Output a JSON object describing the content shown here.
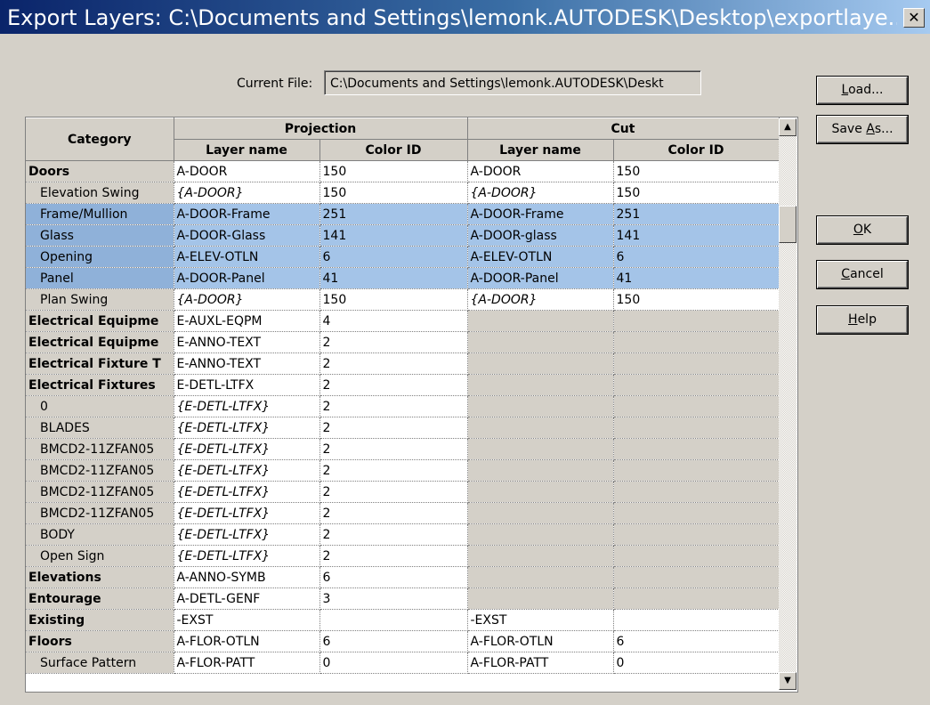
{
  "window": {
    "title": "Export Layers: C:\\Documents and Settings\\lemonk.AUTODESK\\Desktop\\exportlaye...",
    "close_glyph": "✕"
  },
  "current_file": {
    "label": "Current File:",
    "value": "C:\\Documents and Settings\\lemonk.AUTODESK\\Deskt"
  },
  "buttons": {
    "load": {
      "pre": "",
      "u": "L",
      "post": "oad..."
    },
    "save_as": {
      "pre": "Save ",
      "u": "A",
      "post": "s..."
    },
    "ok": {
      "pre": "",
      "u": "O",
      "post": "K"
    },
    "cancel": {
      "pre": "",
      "u": "C",
      "post": "ancel"
    },
    "help": {
      "pre": "",
      "u": "H",
      "post": "elp"
    }
  },
  "grid": {
    "headers": {
      "category": "Category",
      "projection": "Projection",
      "cut": "Cut",
      "layer_name": "Layer name",
      "color_id": "Color ID"
    },
    "rows": [
      {
        "category": "Doors",
        "level": "top",
        "p_layer": "A-DOOR",
        "p_color": "150",
        "c_layer": "A-DOOR",
        "c_color": "150"
      },
      {
        "category": "Elevation Swing",
        "level": "sub",
        "p_layer": "{A-DOOR}",
        "p_color": "150",
        "c_layer": "{A-DOOR}",
        "c_color": "150",
        "italic": true
      },
      {
        "category": "Frame/Mullion",
        "level": "sub",
        "p_layer": "A-DOOR-Frame",
        "p_color": "251",
        "c_layer": "A-DOOR-Frame",
        "c_color": "251",
        "selected": true
      },
      {
        "category": "Glass",
        "level": "sub",
        "p_layer": "A-DOOR-Glass",
        "p_color": "141",
        "c_layer": "A-DOOR-glass",
        "c_color": "141",
        "selected": true
      },
      {
        "category": "Opening",
        "level": "sub",
        "p_layer": "A-ELEV-OTLN",
        "p_color": "6",
        "c_layer": "A-ELEV-OTLN",
        "c_color": "6",
        "selected": true
      },
      {
        "category": "Panel",
        "level": "sub",
        "p_layer": "A-DOOR-Panel",
        "p_color": "41",
        "c_layer": "A-DOOR-Panel",
        "c_color": "41",
        "selected": true
      },
      {
        "category": "Plan Swing",
        "level": "sub",
        "p_layer": "{A-DOOR}",
        "p_color": "150",
        "c_layer": "{A-DOOR}",
        "c_color": "150",
        "italic": true
      },
      {
        "category": "Electrical Equipme",
        "level": "top",
        "p_layer": "E-AUXL-EQPM",
        "p_color": "4",
        "cut_disabled": true
      },
      {
        "category": "Electrical Equipme",
        "level": "top",
        "p_layer": "E-ANNO-TEXT",
        "p_color": "2",
        "cut_disabled": true
      },
      {
        "category": "Electrical Fixture T",
        "level": "top",
        "p_layer": "E-ANNO-TEXT",
        "p_color": "2",
        "cut_disabled": true
      },
      {
        "category": "Electrical Fixtures",
        "level": "top",
        "p_layer": "E-DETL-LTFX",
        "p_color": "2",
        "cut_disabled": true
      },
      {
        "category": "0",
        "level": "sub",
        "p_layer": "{E-DETL-LTFX}",
        "p_color": "2",
        "italic": true,
        "cut_disabled": true
      },
      {
        "category": "BLADES",
        "level": "sub",
        "p_layer": "{E-DETL-LTFX}",
        "p_color": "2",
        "italic": true,
        "cut_disabled": true
      },
      {
        "category": "BMCD2-11ZFAN05",
        "level": "sub",
        "p_layer": "{E-DETL-LTFX}",
        "p_color": "2",
        "italic": true,
        "cut_disabled": true
      },
      {
        "category": "BMCD2-11ZFAN05",
        "level": "sub",
        "p_layer": "{E-DETL-LTFX}",
        "p_color": "2",
        "italic": true,
        "cut_disabled": true
      },
      {
        "category": "BMCD2-11ZFAN05",
        "level": "sub",
        "p_layer": "{E-DETL-LTFX}",
        "p_color": "2",
        "italic": true,
        "cut_disabled": true
      },
      {
        "category": "BMCD2-11ZFAN05",
        "level": "sub",
        "p_layer": "{E-DETL-LTFX}",
        "p_color": "2",
        "italic": true,
        "cut_disabled": true
      },
      {
        "category": "BODY",
        "level": "sub",
        "p_layer": "{E-DETL-LTFX}",
        "p_color": "2",
        "italic": true,
        "cut_disabled": true
      },
      {
        "category": "Open Sign",
        "level": "sub",
        "p_layer": "{E-DETL-LTFX}",
        "p_color": "2",
        "italic": true,
        "cut_disabled": true
      },
      {
        "category": "Elevations",
        "level": "top",
        "p_layer": "A-ANNO-SYMB",
        "p_color": "6",
        "cut_disabled": true
      },
      {
        "category": "Entourage",
        "level": "top",
        "p_layer": "A-DETL-GENF",
        "p_color": "3",
        "cut_disabled": true
      },
      {
        "category": "Existing",
        "level": "top",
        "p_layer": "-EXST",
        "p_color": "",
        "c_layer": "-EXST",
        "c_color": ""
      },
      {
        "category": "Floors",
        "level": "top",
        "p_layer": "A-FLOR-OTLN",
        "p_color": "6",
        "c_layer": "A-FLOR-OTLN",
        "c_color": "6"
      },
      {
        "category": "Surface Pattern",
        "level": "sub",
        "p_layer": "A-FLOR-PATT",
        "p_color": "0",
        "c_layer": "A-FLOR-PATT",
        "c_color": "0"
      }
    ]
  },
  "scrollbar": {
    "up_icon": "▲",
    "down_icon": "▼"
  }
}
